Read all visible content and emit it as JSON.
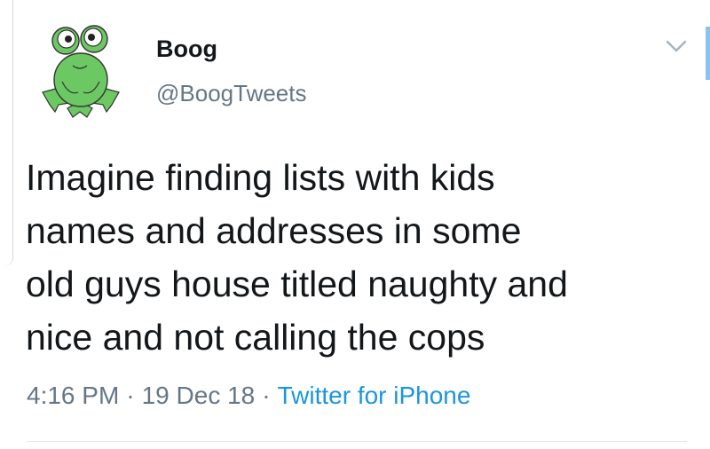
{
  "user": {
    "name": "Boog",
    "handle": "@BoogTweets",
    "avatar_icon": "frog-avatar-icon"
  },
  "menu": {
    "icon": "chevron-down-icon"
  },
  "tweet": {
    "text": "Imagine finding lists with kids\nnames and addresses in some\nold guys house titled naughty and\nnice and not calling the cops",
    "time": "4:16 PM",
    "date": "19 Dec 18",
    "source": "Twitter for iPhone",
    "separator": "·"
  },
  "colors": {
    "text": "#14171a",
    "secondary": "#657786",
    "link": "#1b95e0",
    "avatar_green": "#6cc862"
  }
}
